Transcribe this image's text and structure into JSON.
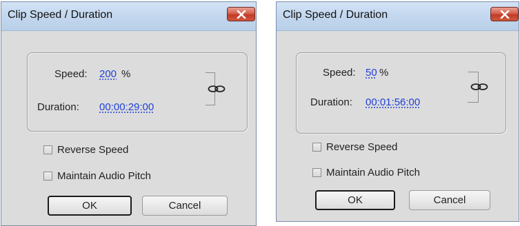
{
  "dialogs": [
    {
      "title": "Clip Speed / Duration",
      "speed_label": "Speed:",
      "speed_value": "200",
      "speed_unit": "%",
      "duration_label": "Duration:",
      "duration_value": "00:00:29:00",
      "reverse_speed_label": "Reverse Speed",
      "reverse_speed_checked": false,
      "maintain_pitch_label": "Maintain Audio Pitch",
      "maintain_pitch_checked": false,
      "ok_label": "OK",
      "cancel_label": "Cancel"
    },
    {
      "title": "Clip Speed / Duration",
      "speed_label": "Speed:",
      "speed_value": "50",
      "speed_unit": "%",
      "duration_label": "Duration:",
      "duration_value": "00:01:56:00",
      "reverse_speed_label": "Reverse Speed",
      "reverse_speed_checked": false,
      "maintain_pitch_label": "Maintain Audio Pitch",
      "maintain_pitch_checked": false,
      "ok_label": "OK",
      "cancel_label": "Cancel"
    }
  ],
  "icons": {
    "close": "close-icon",
    "link": "chain-link-icon"
  },
  "colors": {
    "value_link": "#1f3fd6",
    "close_button": "#c84a33",
    "title_bar": "#c4d8ef"
  }
}
